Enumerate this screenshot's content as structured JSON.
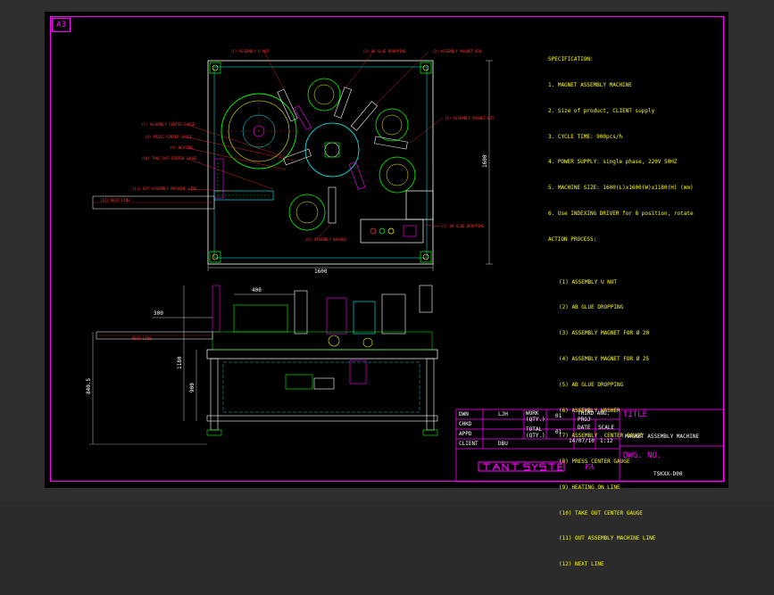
{
  "sheet_size": "A3",
  "specification": {
    "heading": "SPECIFICATION:",
    "items": [
      "1. MAGNET ASSEMBLY MACHINE",
      "2. Size of product, CLIENT supply",
      "3. CYCLE TIME: 900pcs/h",
      "4. POWER SUPPLY: single phase, 220V 50HZ",
      "5. MACHINE SIZE: 1600(L)x1600(W)x1180(H) (mm)",
      "6. Use INDEXING DRIVER for 8 position, rotate"
    ],
    "process_heading": "ACTION PROCESS:",
    "process": [
      "(1) ASSEMBLY U NUT",
      "(2) AB GLUE DROPPING",
      "(3) ASSEMBLY MAGNET FOR Ø 20",
      "(4) ASSEMBLY MAGNET FOR Ø 25",
      "(5) AB GLUE DROPPING",
      "(6) ASSEMBLY WASHER",
      "(7) ASSEMBLY  CENTER GAUGE",
      "(8) PRESS CENTER GAUGE",
      "(9) HEATING ON LINE",
      "(10) TAKE OUT CENTER GAUGE",
      "(11) OUT ASSEMBLY MACHINE LINE",
      "(12) NEXT LINE"
    ]
  },
  "callouts": {
    "c1": "(1) ASSEMBLY U NUT",
    "c2": "(2) AB GLUE DROPPING",
    "c3": "(3) ASSEMBLY MAGNET Ø20",
    "c4": "(4) ASSEMBLY MAGNET Ø25",
    "c5": "(5) AB GLUE DROPPING",
    "c6": "(6) ASSEMBLY WASHER",
    "c7": "(7) ASSEMBLY CENTER GAUGE",
    "c8": "(8) PRESS CENTER GAUGE",
    "c9": "(9) HEATING",
    "c10": "(10) TAKE OUT CENTER GAUGE",
    "c11": "(11) OUT ASSEMBLY MACHINE LINE",
    "c12": "(12) NEXT LINE",
    "c13": "NEXT LINE"
  },
  "dimensions": {
    "plan_width": "1600",
    "plan_height": "1600",
    "side_400": "400",
    "side_300": "300",
    "h_1180": "1180",
    "h_900": "900",
    "h_8405": "840.5"
  },
  "title_block": {
    "dwn_label": "DWN",
    "dwn_value": "LJH",
    "chkd_label": "CHKD",
    "appd_label": "APPD",
    "client_label": "CLIENT",
    "client_value": "DBU",
    "work_qty_label": "WORK (QTY.)",
    "work_qty_value": "01",
    "total_qty_label": "TOTAL (QTY.)",
    "total_qty_value": "01",
    "third_angle_label": "THIRD ANG. PROJ",
    "date_label": "DATE",
    "date_value": "14/07/10",
    "scale_label": "SCALE",
    "scale_value": "1:12",
    "title_label": "TITLE",
    "title_value": "MAGNET ASSEMBLY MACHINE",
    "dwg_no_label": "DWG. NO.",
    "dwg_no_value": "TSKXX-D00",
    "company_suffix": "FA"
  },
  "colors": {
    "background": "#000000",
    "frame": "#ff00ff",
    "spec_text": "#ffff00",
    "callout": "#ff3030",
    "machine_cyan": "#00ffff",
    "machine_green": "#00ff00"
  }
}
